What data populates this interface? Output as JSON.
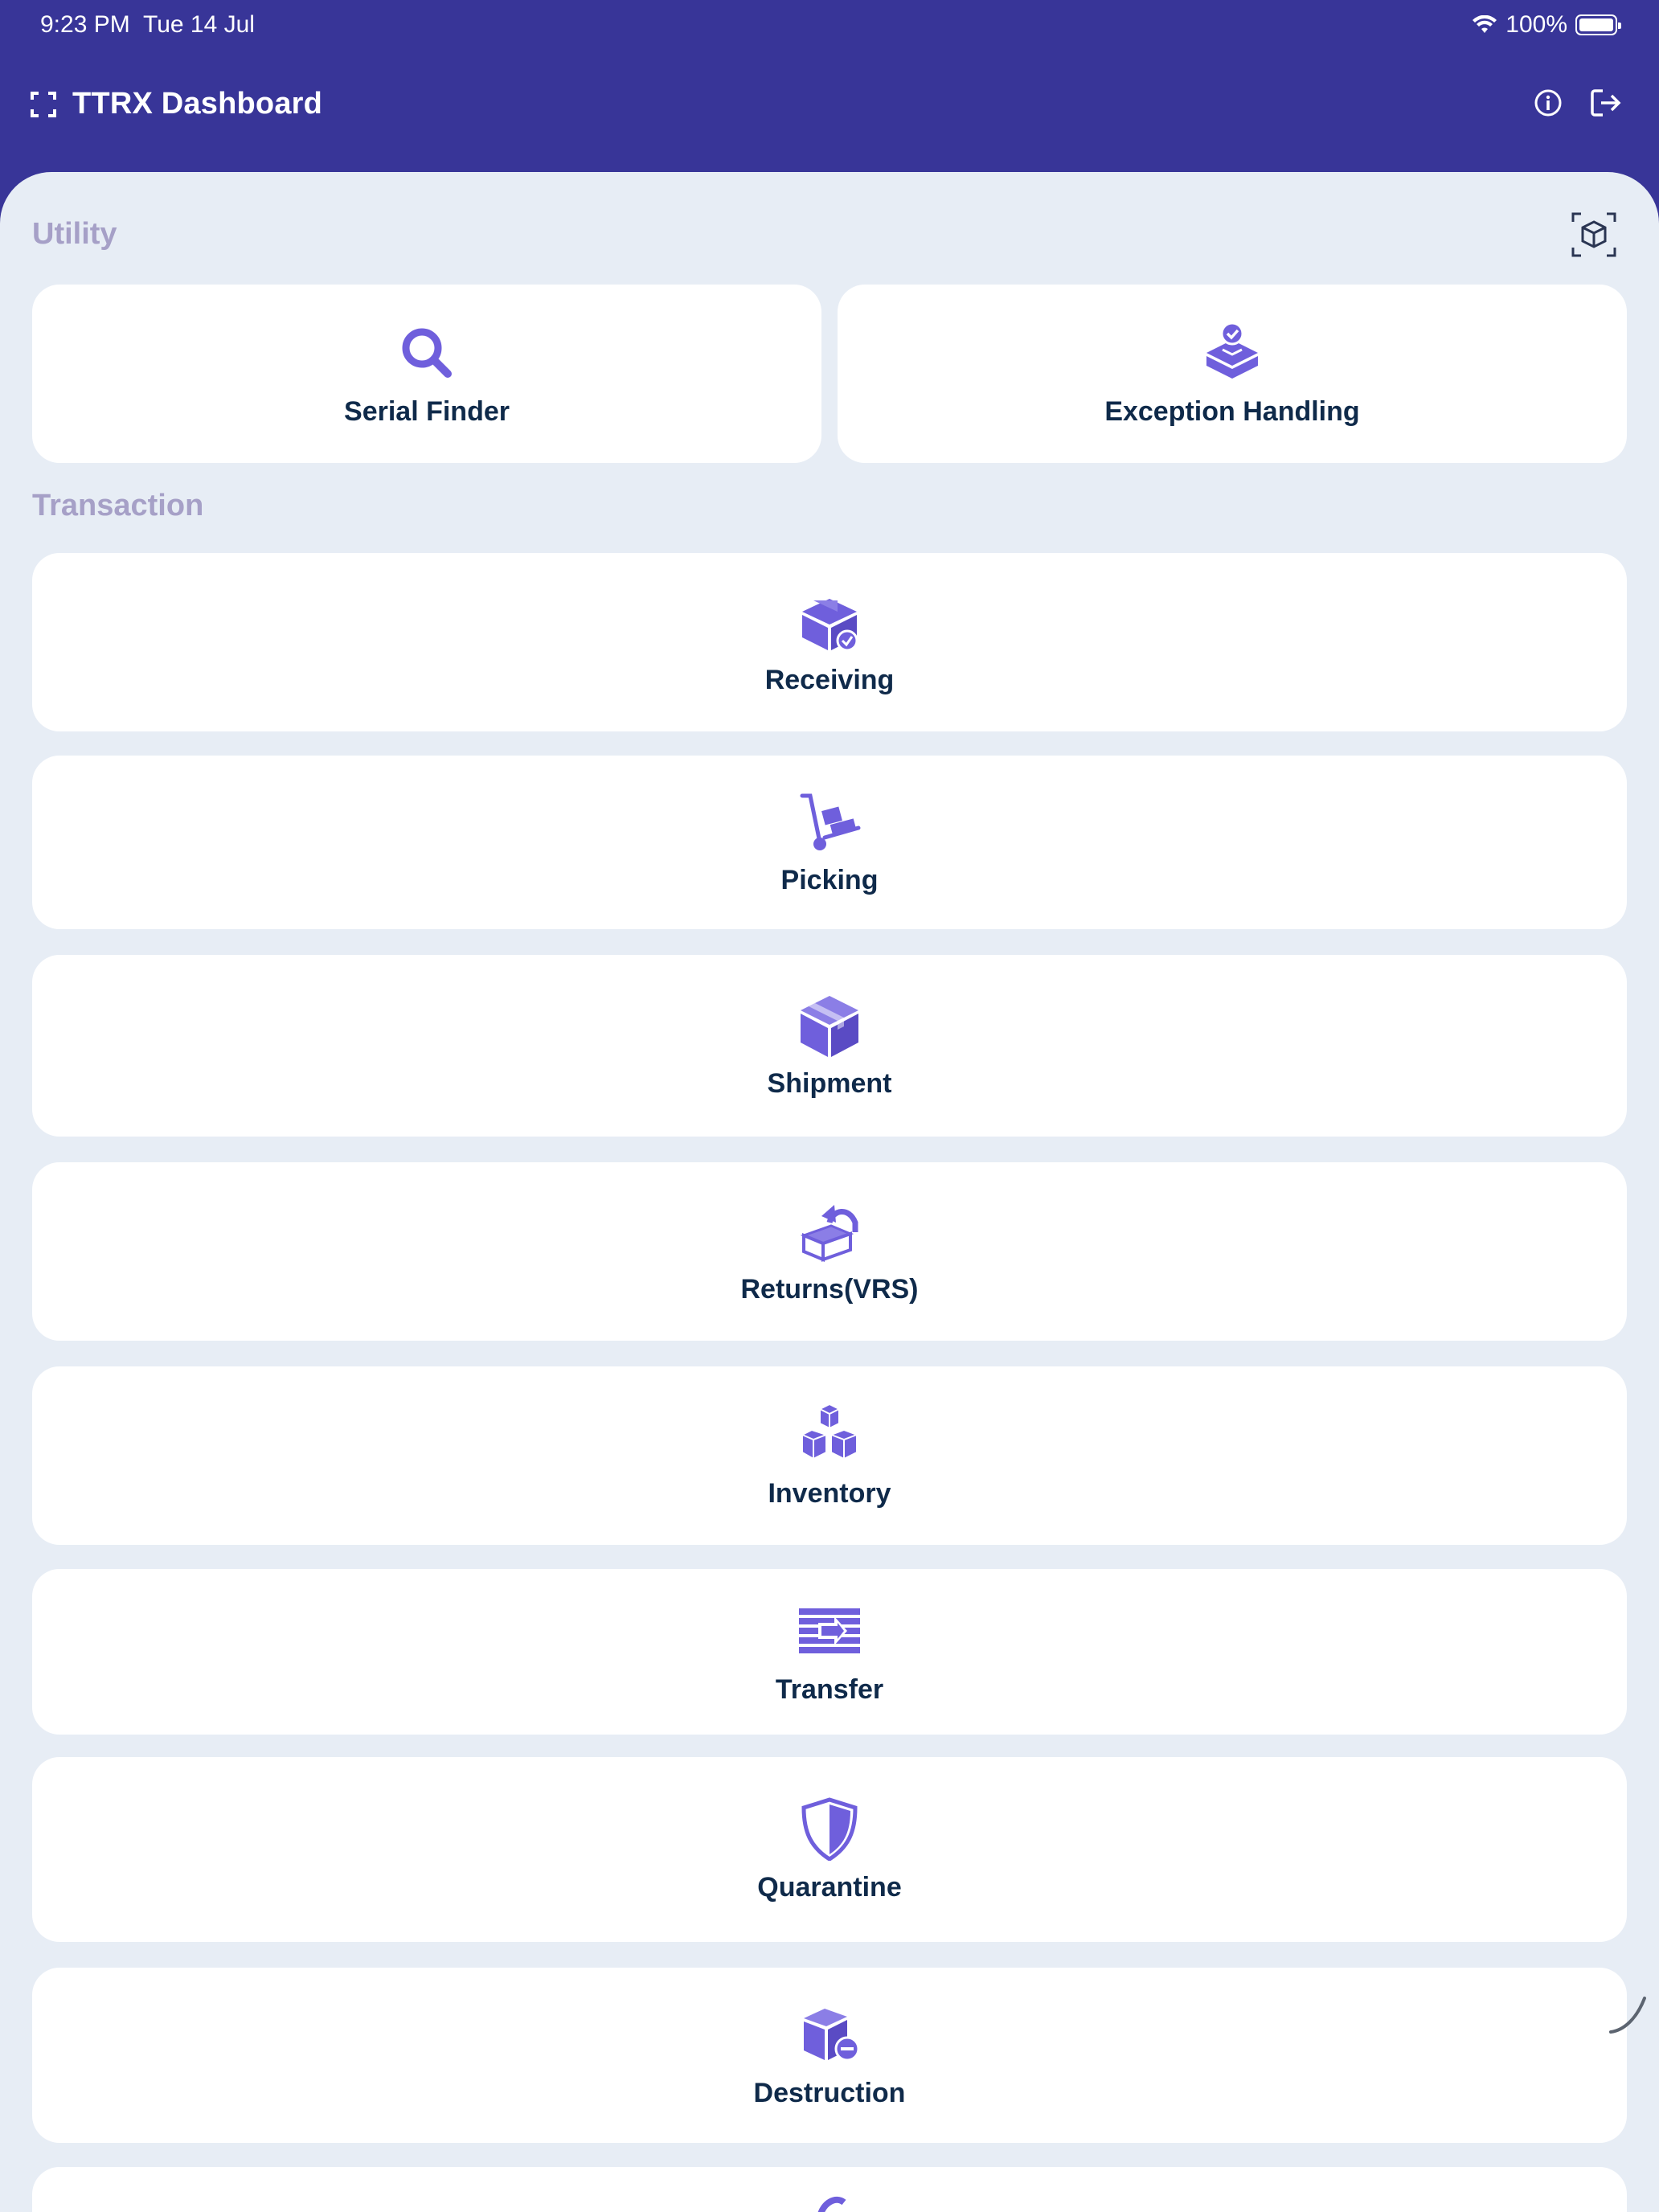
{
  "status": {
    "time": "9:23 PM",
    "date": "Tue 14 Jul",
    "battery": "100%"
  },
  "header": {
    "title": "TTRX Dashboard"
  },
  "sections": {
    "utility": "Utility",
    "transaction": "Transaction"
  },
  "utility_items": [
    {
      "label": "Serial Finder",
      "icon": "search-icon"
    },
    {
      "label": "Exception Handling",
      "icon": "box-check-icon"
    }
  ],
  "transaction_items": [
    {
      "label": "Receiving",
      "icon": "receiving-box-icon"
    },
    {
      "label": "Picking",
      "icon": "hand-truck-icon"
    },
    {
      "label": "Shipment",
      "icon": "package-icon"
    },
    {
      "label": "Returns(VRS)",
      "icon": "return-box-icon"
    },
    {
      "label": "Inventory",
      "icon": "stacked-boxes-icon"
    },
    {
      "label": "Transfer",
      "icon": "transfer-icon"
    },
    {
      "label": "Quarantine",
      "icon": "shield-icon"
    },
    {
      "label": "Destruction",
      "icon": "box-remove-icon"
    }
  ],
  "colors": {
    "header_bg": "#383598",
    "accent": "#6f5fdc",
    "label": "#0f2a4a",
    "section": "#a6a0c7",
    "content_bg": "#e7edf5"
  }
}
